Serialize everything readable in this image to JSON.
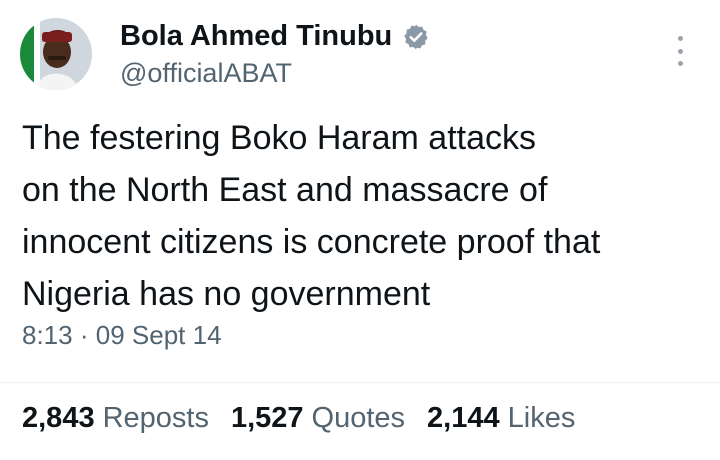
{
  "author": {
    "name": "Bola Ahmed Tinubu",
    "handle": "@officialABAT",
    "verified_color": "#8b98a5"
  },
  "tweet": {
    "lines": [
      "The festering Boko Haram attacks",
      "on the North East and massacre of",
      "innocent citizens is concrete proof that",
      "Nigeria has no government"
    ],
    "time": "8:13",
    "separator": "·",
    "date": "09 Sept 14"
  },
  "stats": [
    {
      "count": "2,843",
      "label": "Reposts"
    },
    {
      "count": "1,527",
      "label": "Quotes"
    },
    {
      "count": "2,144",
      "label": "Likes"
    }
  ],
  "icons": {
    "more": "more-options-icon",
    "verified": "verified-badge-icon"
  },
  "colors": {
    "text_primary": "#0f1419",
    "text_secondary": "#536471",
    "divider": "#eff3f4"
  }
}
